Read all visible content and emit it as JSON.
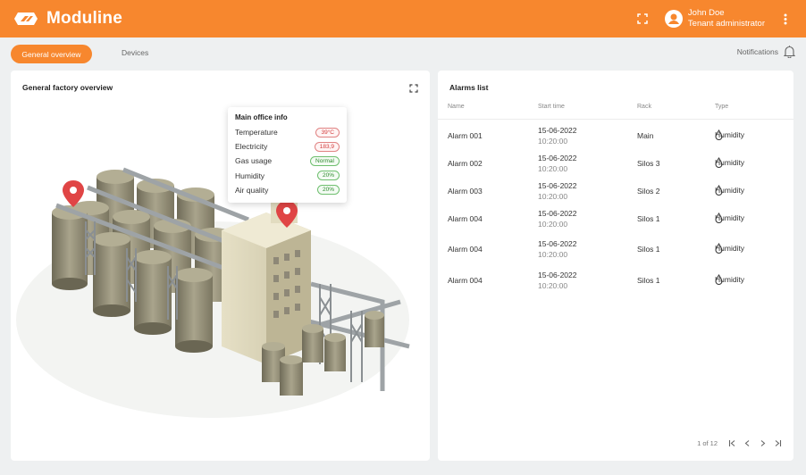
{
  "app": {
    "name": "Moduline"
  },
  "user": {
    "name": "John Doe",
    "role": "Tenant administrator"
  },
  "nav": {
    "tabs": [
      {
        "label": "General overview"
      },
      {
        "label": "Devices"
      }
    ],
    "notifications_label": "Notifications"
  },
  "overview": {
    "title": "General factory overview",
    "popup": {
      "title": "Main office info",
      "rows": [
        {
          "label": "Temperature",
          "value": "39°C",
          "status": "red"
        },
        {
          "label": "Electricity",
          "value": "183,9",
          "status": "red"
        },
        {
          "label": "Gas usage",
          "value": "Normal",
          "status": "green"
        },
        {
          "label": "Humidity",
          "value": "20%",
          "status": "green"
        },
        {
          "label": "Air quality",
          "value": "20%",
          "status": "green"
        }
      ]
    }
  },
  "alarms": {
    "title": "Alarms list",
    "columns": [
      "Name",
      "Start time",
      "Rack",
      "Type"
    ],
    "rows": [
      {
        "name": "Alarm 001",
        "date": "15-06-2022",
        "time": "10:20:00",
        "rack": "Main",
        "type": "Humidity"
      },
      {
        "name": "Alarm 002",
        "date": "15-06-2022",
        "time": "10:20:00",
        "rack": "Silos 3",
        "type": "Humidity"
      },
      {
        "name": "Alarm 003",
        "date": "15-06-2022",
        "time": "10:20:00",
        "rack": "Silos 2",
        "type": "Humidity"
      },
      {
        "name": "Alarm 004",
        "date": "15-06-2022",
        "time": "10:20:00",
        "rack": "Silos 1",
        "type": "Humidity"
      },
      {
        "name": "Alarm 004",
        "date": "15-06-2022",
        "time": "10:20:00",
        "rack": "Silos 1",
        "type": "Humidity"
      },
      {
        "name": "Alarm 004",
        "date": "15-06-2022",
        "time": "10:20:00",
        "rack": "Silos 1",
        "type": "Humidity"
      }
    ],
    "pager": {
      "label": "1 of 12"
    }
  },
  "colors": {
    "accent": "#f7872e",
    "badge_red": "#d23b3b",
    "badge_green": "#2d8a2d",
    "pin": "#e04545"
  },
  "icons": [
    "logo-icon",
    "fullscreen-icon",
    "account-icon",
    "more-vert-icon",
    "bell-icon",
    "droplet-icon",
    "first-page-icon",
    "prev-page-icon",
    "next-page-icon",
    "last-page-icon",
    "map-pin-icon"
  ]
}
